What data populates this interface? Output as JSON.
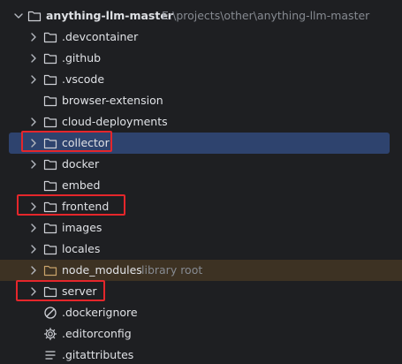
{
  "project": {
    "name": "anything-llm-master",
    "path": "E:\\projects\\other\\anything-llm-master"
  },
  "items": [
    {
      "label": ".devcontainer",
      "kind": "folder",
      "expandable": true
    },
    {
      "label": ".github",
      "kind": "folder",
      "expandable": true
    },
    {
      "label": ".vscode",
      "kind": "folder",
      "expandable": true
    },
    {
      "label": "browser-extension",
      "kind": "folder",
      "expandable": false
    },
    {
      "label": "cloud-deployments",
      "kind": "folder",
      "expandable": true
    },
    {
      "label": "collector",
      "kind": "folder",
      "expandable": true,
      "selected": true,
      "highlighted": true
    },
    {
      "label": "docker",
      "kind": "folder",
      "expandable": true
    },
    {
      "label": "embed",
      "kind": "folder",
      "expandable": false
    },
    {
      "label": "frontend",
      "kind": "folder",
      "expandable": true,
      "highlighted": true
    },
    {
      "label": "images",
      "kind": "folder",
      "expandable": true
    },
    {
      "label": "locales",
      "kind": "folder",
      "expandable": true
    },
    {
      "label": "node_modules",
      "kind": "folder-excluded",
      "expandable": true,
      "hint": "library root"
    },
    {
      "label": "server",
      "kind": "folder",
      "expandable": true,
      "highlighted": true
    },
    {
      "label": ".dockerignore",
      "kind": "ignore-file",
      "expandable": false
    },
    {
      "label": ".editorconfig",
      "kind": "config-file",
      "expandable": false
    },
    {
      "label": ".gitattributes",
      "kind": "text-file",
      "expandable": false
    }
  ],
  "colors": {
    "background": "#1e1f22",
    "selection": "#2e436e",
    "excluded_row": "#3d3223",
    "highlight_box": "#e5262b",
    "hint_text": "#868a91"
  },
  "icons": {
    "chevron": "chevron-right-icon",
    "chevron_open": "chevron-down-icon",
    "folder": "folder-icon",
    "ignore": "ignore-file-icon",
    "config": "gear-icon",
    "text": "text-file-icon"
  }
}
